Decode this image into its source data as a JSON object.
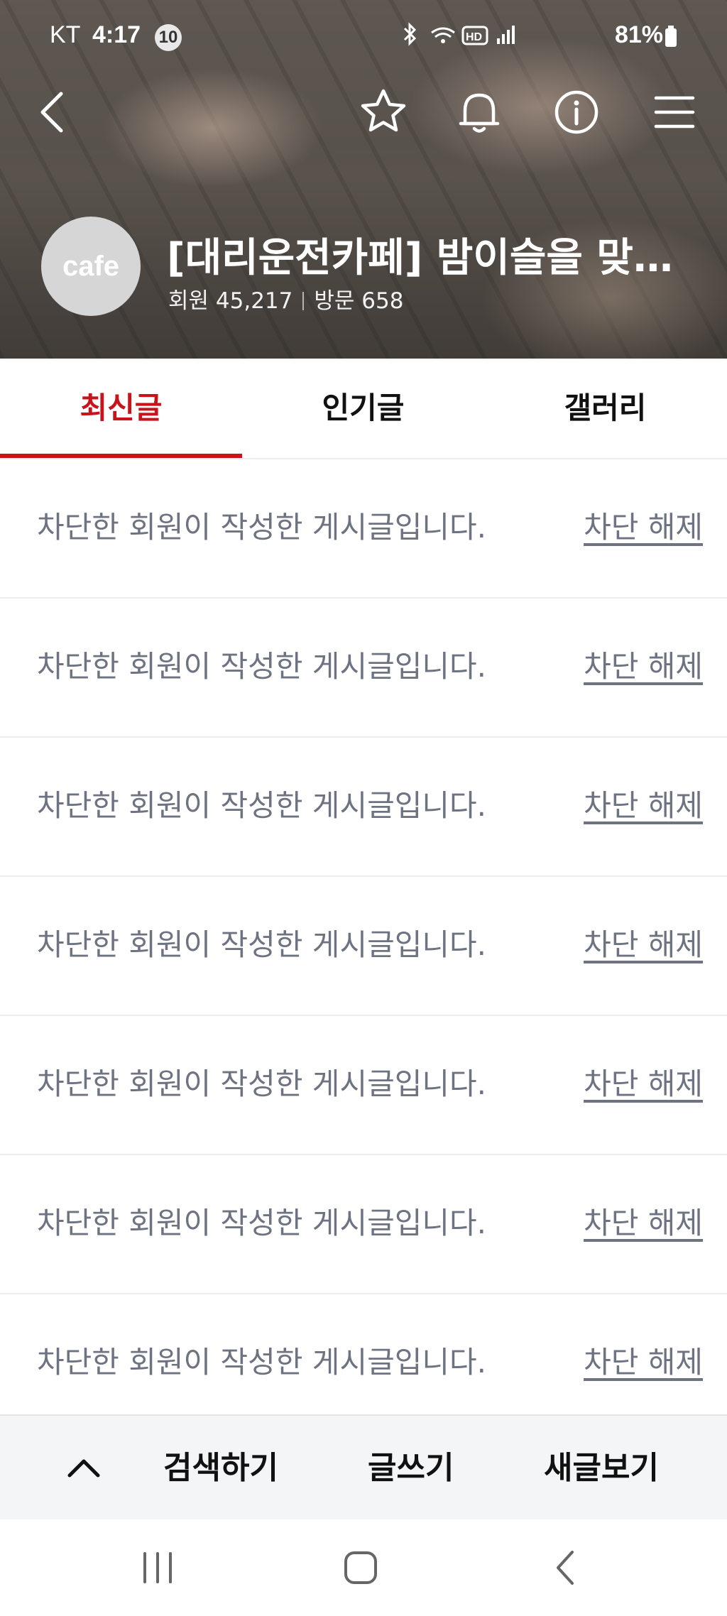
{
  "status_bar": {
    "carrier": "KT",
    "time": "4:17",
    "notification_count": "10",
    "battery": "81%"
  },
  "header": {
    "cafe_logo_text": "cafe",
    "title": "[대리운전카페] 밤이슬을 맞…",
    "members": "회원 45,217",
    "visits": "방문 658"
  },
  "tabs": [
    {
      "label": "최신글",
      "active": true
    },
    {
      "label": "인기글",
      "active": false
    },
    {
      "label": "갤러리",
      "active": false
    }
  ],
  "posts": [
    {
      "message": "차단한 회원이 작성한 게시글입니다.",
      "action": "차단 해제"
    },
    {
      "message": "차단한 회원이 작성한 게시글입니다.",
      "action": "차단 해제"
    },
    {
      "message": "차단한 회원이 작성한 게시글입니다.",
      "action": "차단 해제"
    },
    {
      "message": "차단한 회원이 작성한 게시글입니다.",
      "action": "차단 해제"
    },
    {
      "message": "차단한 회원이 작성한 게시글입니다.",
      "action": "차단 해제"
    },
    {
      "message": "차단한 회원이 작성한 게시글입니다.",
      "action": "차단 해제"
    },
    {
      "message": "차단한 회원이 작성한 게시글입니다.",
      "action": "차단 해제"
    }
  ],
  "toolbar": {
    "search_label": "검색하기",
    "write_label": "글쓰기",
    "new_posts_label": "새글보기"
  },
  "colors": {
    "accent": "#c8131b",
    "muted_text": "#6e7382",
    "toolbar_bg": "#f4f5f7"
  },
  "icons": {
    "back": "chevron-left-icon",
    "favorite": "star-icon",
    "notifications": "bell-icon",
    "info": "info-icon",
    "menu": "hamburger-menu-icon",
    "scroll_top": "chevron-up-icon",
    "recents": "recent-apps-icon",
    "home": "home-icon",
    "system_back": "system-back-icon"
  }
}
